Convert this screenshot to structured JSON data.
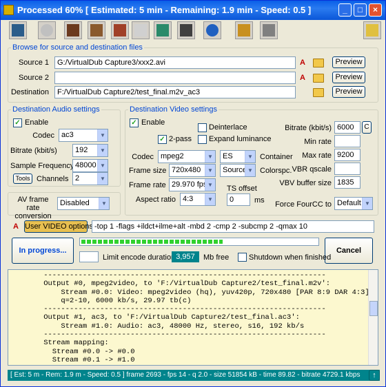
{
  "title": "Processed  60%  [ Estimated: 5 min - Remaining: 1.9 min - Speed: 0.5 ]",
  "window_buttons": [
    "_",
    "□",
    "×"
  ],
  "toolbar_icons": [
    "film-icon",
    "cd-icon",
    "video-strip-icon",
    "video-strip2-icon",
    "video-strip3-icon",
    "edit-icon",
    "chart-icon",
    "copy-icon",
    "refresh-icon",
    "numbers-icon",
    "help-icon"
  ],
  "files": {
    "group_title": "Browse for source and destination files",
    "source1_label": "Source 1",
    "source1_value": "G:/VirtualDub Capture3/xxx2.avi",
    "source2_label": "Source 2",
    "source2_value": "",
    "dest_label": "Destination",
    "dest_value": "F:/VirtualDub Capture2/test_final.m2v_ac3",
    "preview": "Preview"
  },
  "audio": {
    "group_title": "Destination Audio settings",
    "enable": "Enable",
    "codec_label": "Codec",
    "codec_value": "ac3",
    "bitrate_label": "Bitrate (kbit/s)",
    "bitrate_value": "192",
    "freq_label": "Sample Frequency",
    "freq_value": "48000",
    "tools": "Tools",
    "channels_label": "Channels",
    "channels_value": "2",
    "avrate_label": "AV frame rate\nconversion",
    "avrate_value": "Disabled"
  },
  "video": {
    "group_title": "Destination Video settings",
    "enable": "Enable",
    "deinterlace": "Deinterlace",
    "twopass": "2-pass",
    "expand": "Expand luminance",
    "codec_label": "Codec",
    "codec_value": "mpeg2",
    "container_value": "ES",
    "container_label": "Container",
    "framesize_label": "Frame size",
    "framesize_value": "720x480",
    "colorspc_value": "Source",
    "colorspc_label": "Colorspc.",
    "framerate_label": "Frame rate",
    "framerate_value": "29.970 fps",
    "tsoffset_label": "TS offset",
    "tsoffset_value": "0",
    "ms": "ms",
    "aspect_label": "Aspect ratio",
    "aspect_value": "4:3",
    "bitrate_label": "Bitrate (kbit/s)",
    "bitrate_value": "6000",
    "c": "C",
    "minrate_label": "Min rate",
    "minrate_value": "",
    "maxrate_label": "Max rate",
    "maxrate_value": "9200",
    "vbr_label": "VBR qscale",
    "vbr_value": "",
    "vbv_label": "VBV buffer size",
    "vbv_value": "1835",
    "fourcc_label": "Force FourCC to",
    "fourcc_value": "Default"
  },
  "user_options": {
    "button": "User VIDEO options >",
    "value": "-top 1 -flags +ildct+ilme+alt -mbd 2 -cmp 2 -subcmp 2 -qmax 10"
  },
  "progress": {
    "button": "In progress...",
    "percent": 60,
    "cancel": "Cancel",
    "limit": "Limit encode duration",
    "free_value": "3,957",
    "free_label": "Mb free",
    "shutdown": "Shutdown when finished"
  },
  "log": "    -----------------------------------------------------------------\n    Output #0, mpeg2video, to 'F:/VirtualDub Capture2/test_final.m2v':\n        Stream #0.0: Video: mpeg2video (hq), yuv420p, 720x480 [PAR 8:9 DAR 4:3],\n        q=2-10, 6000 kb/s, 29.97 tb(c)\n    -----------------------------------------------------------------\n    Output #1, ac3, to 'F:/VirtualDub Capture2/test_final.ac3':\n        Stream #1.0: Audio: ac3, 48000 Hz, stereo, s16, 192 kb/s\n    -----------------------------------------------------------------\n    Stream mapping:\n      Stream #0.0 -> #0.0\n      Stream #0.1 -> #1.0\n    -----------------------------------------------------------------",
  "status": "[ Est: 5 m - Rem: 1.9 m - Speed: 0.5 ]    frame 2693 - fps 14 - q 2.0 - size 51854 kB - time 89.82 - bitrate 4729.1 kbps"
}
